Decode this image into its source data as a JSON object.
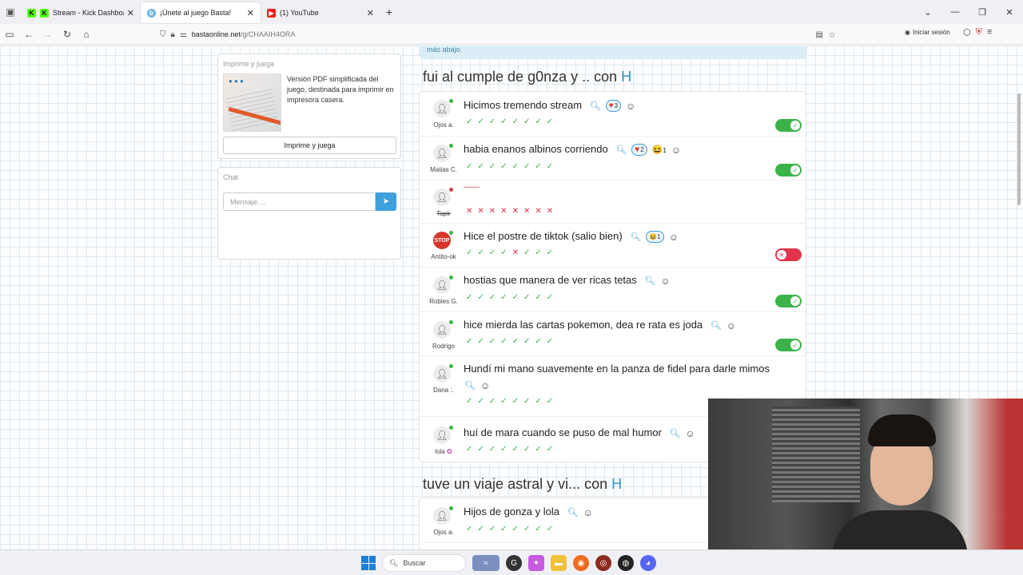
{
  "browser": {
    "tabs": [
      {
        "label": "Stream - Kick Dashboard",
        "favicon": "kick-icon",
        "active": false
      },
      {
        "label": "¡Únete al juego Basta!",
        "favicon": "basta-icon",
        "active": true
      },
      {
        "label": "(1) YouTube",
        "favicon": "youtube-icon",
        "active": false
      }
    ],
    "url_host": "bastaonline.net",
    "url_path": "/g/CHAAIH4ORA",
    "signin_label": "Iniciar sesión"
  },
  "print_card": {
    "title": "Imprime y juega",
    "description": "Versión PDF simplificada del juego, destinada para imprimir en impresora casera.",
    "button": "Imprime y juega"
  },
  "chat": {
    "title": "Chat",
    "placeholder": "Mensaje...."
  },
  "banner": {
    "text": "más abajo."
  },
  "rounds": [
    {
      "title": "fui al cumple de g0nza y .. con ",
      "letter": "H",
      "answers": [
        {
          "user": "Ojos a.",
          "text": "Hicimos tremendo stream",
          "hearts": "3",
          "laugh": "",
          "votes": "✓ ✓ ✓ ✓ ✓ ✓ ✓ ✓",
          "valid": true
        },
        {
          "user": "Matias C.",
          "text": "habia enanos albinos corriendo",
          "hearts": "2",
          "laugh": "1",
          "votes": "✓ ✓ ✓ ✓ ✓ ✓ ✓ ✓",
          "valid": true
        },
        {
          "user": "Tapir",
          "text": "——",
          "hearts": "",
          "laugh": "",
          "votes": "✕ ✕ ✕ ✕ ✕ ✕ ✕ ✕",
          "valid": null
        },
        {
          "user": "Antito-ok",
          "text": "Hice el postre de tiktok (salio bien)",
          "hearts": "",
          "laugh": "1",
          "votes": "✓ ✓ ✓ ✓ ✕ ✓ ✓ ✓",
          "valid": false
        },
        {
          "user": "Robles G.",
          "text": "hostias que manera de ver ricas tetas",
          "hearts": "",
          "laugh": "",
          "votes": "✓ ✓ ✓ ✓ ✓ ✓ ✓ ✓",
          "valid": true
        },
        {
          "user": "Rodrigo",
          "text": "hice mierda las cartas pokemon, dea re rata es joda",
          "hearts": "",
          "laugh": "",
          "votes": "✓ ✓ ✓ ✓ ✓ ✓ ✓ ✓",
          "valid": true
        },
        {
          "user": "Dana :.",
          "text": "Hundí mi mano suavemente en la panza de fidel para darle mimos",
          "hearts": "",
          "laugh": "",
          "votes": "✓ ✓ ✓ ✓ ✓ ✓ ✓ ✓",
          "valid": true
        },
        {
          "user": "lola",
          "text": "huí de mara cuando se puso de mal humor",
          "hearts": "",
          "laugh": "",
          "votes": "✓ ✓ ✓ ✓ ✓ ✓ ✓ ✓",
          "valid": true
        }
      ]
    },
    {
      "title": "tuve un viaje astral y vi... con ",
      "letter": "H",
      "answers": [
        {
          "user": "Ojos a.",
          "text": "Hijos de gonza y lola",
          "hearts": "",
          "laugh": "",
          "votes": "✓ ✓ ✓ ✓ ✓ ✓ ✓ ✓",
          "valid": true
        }
      ]
    }
  ],
  "taskbar": {
    "search_label": "Buscar"
  },
  "colors": {
    "accent": "#3a9ad5",
    "valid": "#3bb34a",
    "invalid": "#e0344a"
  }
}
